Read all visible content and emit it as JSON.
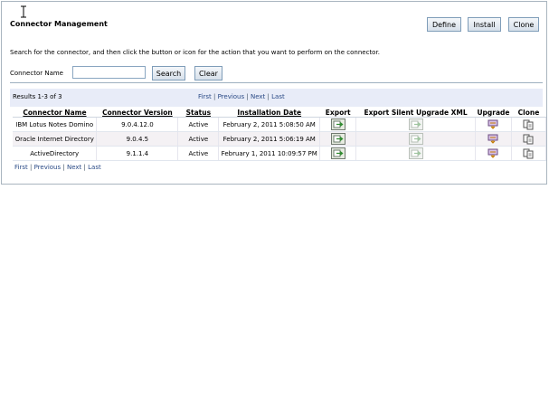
{
  "page": {
    "title": "Connector Management",
    "instructions": "Search for the connector, and then click the button or icon for the action that you want to perform on the connector."
  },
  "toolbar": {
    "define": "Define",
    "install": "Install",
    "clone": "Clone"
  },
  "search": {
    "label": "Connector Name",
    "value": "",
    "search_button": "Search",
    "clear_button": "Clear"
  },
  "results": {
    "summary": "Results 1-3 of 3",
    "pager": {
      "first": "First",
      "previous": "Previous",
      "next": "Next",
      "last": "Last",
      "sep": "|"
    }
  },
  "table": {
    "headers": [
      "Connector Name",
      "Connector Version",
      "Status",
      "Installation Date",
      "Export",
      "Export Silent Upgrade XML",
      "Upgrade",
      "Clone"
    ],
    "rows": [
      {
        "name": "IBM Lotus Notes Domino",
        "version": "9.0.4.12.0",
        "status": "Active",
        "date": "February 2, 2011 5:08:50 AM"
      },
      {
        "name": "Oracle Internet Directory",
        "version": "9.0.4.5",
        "status": "Active",
        "date": "February 2, 2011 5:06:19 AM"
      },
      {
        "name": "ActiveDirectory",
        "version": "9.1.1.4",
        "status": "Active",
        "date": "February 1, 2011 10:09:57 PM"
      }
    ]
  },
  "icons": {
    "export": "export-icon",
    "export_silent": "export-silent-icon",
    "upgrade": "upgrade-icon",
    "clone": "clone-icon"
  },
  "colors": {
    "accent_link": "#2a4a86",
    "results_bar": "#e8ecf8"
  }
}
